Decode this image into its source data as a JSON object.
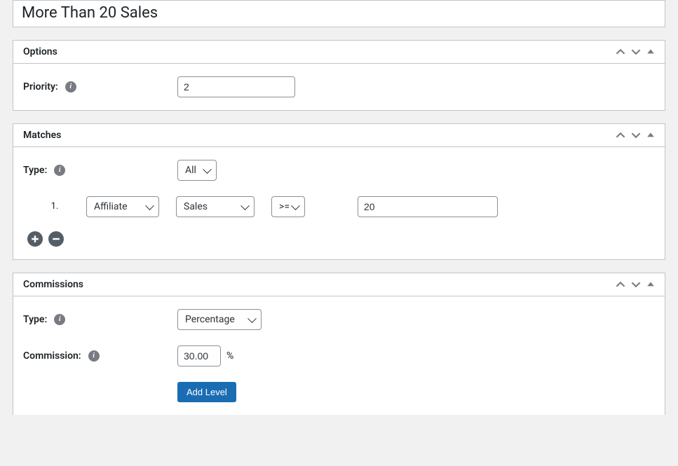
{
  "title": "More Than 20 Sales",
  "options": {
    "heading": "Options",
    "priority_label": "Priority:",
    "priority_value": "2"
  },
  "matches": {
    "heading": "Matches",
    "type_label": "Type:",
    "type_value": "All",
    "condition": {
      "index": "1.",
      "subject": "Affiliate",
      "metric": "Sales",
      "operator": ">=",
      "value": "20"
    }
  },
  "commissions": {
    "heading": "Commissions",
    "type_label": "Type:",
    "type_value": "Percentage",
    "commission_label": "Commission:",
    "commission_value": "30.00",
    "suffix": "%",
    "add_level_label": "Add Level"
  }
}
